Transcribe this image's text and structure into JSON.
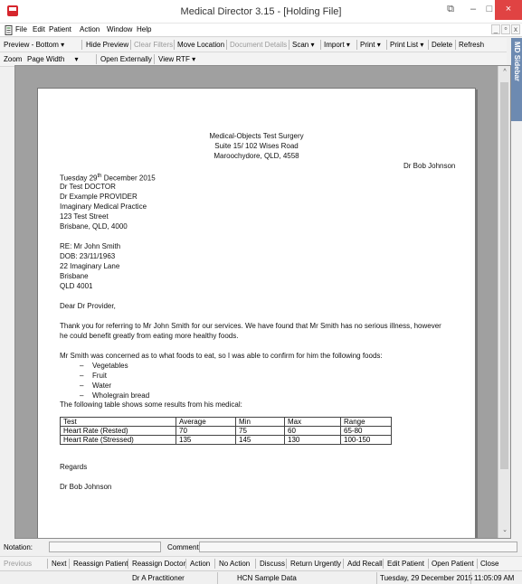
{
  "window": {
    "title": "Medical Director 3.15 - [Holding File]",
    "close_glyph": "×",
    "minimize_glyph": "–",
    "maximize_glyph": "□",
    "restore_glyph": "⧉"
  },
  "menu": {
    "items": [
      "File",
      "Edit",
      "Patient",
      "Action",
      "Window",
      "Help"
    ],
    "mdi_minimize": "_",
    "mdi_restore": "ᵒ",
    "mdi_close": "x"
  },
  "toolbar1": {
    "preview_position": "Preview - Bottom",
    "hide_preview": "Hide Preview",
    "clear_filters": "Clear Filters",
    "move_location": "Move Location",
    "document_details": "Document Details",
    "scan": "Scan",
    "import": "Import",
    "print": "Print",
    "print_list": "Print List",
    "delete": "Delete",
    "refresh": "Refresh",
    "dropdown_glyph": "▾"
  },
  "toolbar2": {
    "zoom_label": "Zoom",
    "zoom_value": "Page Width",
    "open_externally": "Open Externally",
    "view_rtf": "View RTF",
    "dropdown_glyph": "▾"
  },
  "sidebar": {
    "label": "Sidebar",
    "logo": "MD"
  },
  "scroll": {
    "up": "^",
    "down": "⌄"
  },
  "letter": {
    "surgery_name": "Medical-Objects Test Surgery",
    "surgery_address1": "Suite 15/ 102 Wises Road",
    "surgery_address2": "Maroochydore, QLD, 4558",
    "from_doctor": "Dr Bob Johnson",
    "date_day": "Tuesday 29",
    "date_sup": "th",
    "date_rest": " December 2015",
    "recipient": [
      "Dr Test DOCTOR",
      "Dr Example PROVIDER",
      "Imaginary Medical Practice",
      "123 Test Street",
      "Brisbane, QLD, 4000"
    ],
    "re": [
      "RE: Mr John Smith",
      "DOB: 23/11/1963",
      "22 Imaginary Lane",
      "Brisbane",
      "QLD 4001"
    ],
    "salutation": "Dear Dr Provider,",
    "para1_line1": "Thank you for referring to Mr John Smith for our services. We have found that Mr Smith has no serious illness, however",
    "para1_line2": "he could benefit greatly from eating more healthy foods.",
    "para2": "Mr Smith was concerned as to what foods to eat, so I was able to confirm for him the following foods:",
    "bullet_glyph": "–",
    "foods": [
      "Vegetables",
      "Fruit",
      "Water",
      "Wholegrain bread"
    ],
    "table_intro": "The following table shows some results from his medical:",
    "table": {
      "headers": [
        "Test",
        "Average",
        "Min",
        "Max",
        "Range"
      ],
      "rows": [
        [
          "Heart Rate (Rested)",
          "70",
          "75",
          "60",
          "65-80"
        ],
        [
          "Heart Rate (Stressed)",
          "135",
          "145",
          "130",
          "100-150"
        ]
      ]
    },
    "closing": "Regards",
    "signature": "Dr Bob Johnson"
  },
  "notation": {
    "label": "Notation:",
    "comment_label": "Comment",
    "notation_value": "",
    "comment_value": ""
  },
  "actions": {
    "previous": "Previous",
    "next": "Next",
    "reassign_patient": "Reassign Patient",
    "reassign_doctor": "Reassign Doctor",
    "action": "Action",
    "no_action": "No Action",
    "discuss": "Discuss",
    "return_urgently": "Return Urgently",
    "add_recall": "Add Recall",
    "edit_patient": "Edit Patient",
    "open_patient": "Open Patient",
    "close": "Close"
  },
  "status": {
    "practitioner": "Dr A Practitioner",
    "database": "HCN Sample Data",
    "date": "Tuesday, 29 December 2015",
    "time": "11:05:09 AM"
  },
  "colors": {
    "close_button": "#e04343",
    "sidebar_tab": "#6d8ab1",
    "app_icon": "#d6262d"
  }
}
